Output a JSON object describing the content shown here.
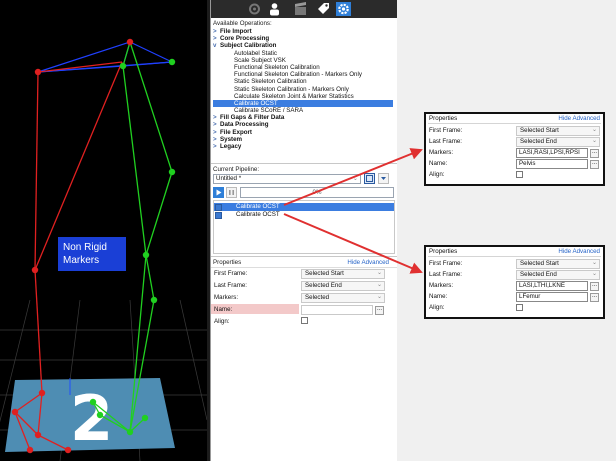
{
  "viewport": {
    "label_line1": "Non Rigid",
    "label_line2": "Markers",
    "floor_number": "2"
  },
  "toolbar": {
    "icons": [
      "gear-icon",
      "subject-icon",
      "clapperboard-icon",
      "tag-icon",
      "settings-icon"
    ],
    "active_icon": "settings-icon",
    "accent": "#2f7fd8"
  },
  "operations": {
    "title": "Available Operations:",
    "items": [
      {
        "label": "File Import",
        "bold": true,
        "expander": ">"
      },
      {
        "label": "Core Processing",
        "bold": true,
        "expander": ">"
      },
      {
        "label": "Subject Calibration",
        "bold": true,
        "expander": "v"
      },
      {
        "label": "Autolabel Static",
        "bold": false
      },
      {
        "label": "Scale Subject VSK",
        "bold": false
      },
      {
        "label": "Functional Skeleton Calibration",
        "bold": false
      },
      {
        "label": "Functional Skeleton Calibration - Markers Only",
        "bold": false
      },
      {
        "label": "Static Skeleton Calibration",
        "bold": false
      },
      {
        "label": "Static Skeleton Calibration - Markers Only",
        "bold": false
      },
      {
        "label": "Calculate Skeleton Joint & Marker Statistics",
        "bold": false
      },
      {
        "label": "Calibrate OCST",
        "bold": false,
        "selected": true
      },
      {
        "label": "Calibrate SCoRE / SARA",
        "bold": false
      },
      {
        "label": "Fill Gaps & Filter Data",
        "bold": true,
        "expander": ">"
      },
      {
        "label": "Data Processing",
        "bold": true,
        "expander": ">"
      },
      {
        "label": "File Export",
        "bold": true,
        "expander": ">"
      },
      {
        "label": "System",
        "bold": true,
        "expander": ">"
      },
      {
        "label": "Legacy",
        "bold": true,
        "expander": ">"
      }
    ]
  },
  "pipeline": {
    "title": "Current Pipeline:",
    "name": "Untitled *",
    "progress_text": "0%",
    "steps": [
      {
        "label": "Calibrate OCST",
        "checked": true,
        "selected": true
      },
      {
        "label": "Calibrate OCST",
        "checked": true,
        "selected": false
      }
    ]
  },
  "properties": {
    "title": "Properties",
    "hide_advanced": "Hide Advanced",
    "first_frame_label": "First Frame:",
    "first_frame_value": "Selected Start",
    "last_frame_label": "Last Frame:",
    "last_frame_value": "Selected End",
    "markers_label": "Markers:",
    "markers_value": "Selected",
    "name_label": "Name:",
    "name_value": "",
    "align_label": "Align:"
  },
  "callout_top": {
    "title": "Properties",
    "hide_advanced": "Hide Advanced",
    "first_frame_label": "First Frame:",
    "first_frame_value": "Selected Start",
    "last_frame_label": "Last Frame:",
    "last_frame_value": "Selected End",
    "markers_label": "Markers:",
    "markers_value": "LASI,RASI,LPSI,RPSI",
    "name_label": "Name:",
    "name_value": "Pelvis",
    "align_label": "Align:"
  },
  "callout_bottom": {
    "title": "Properties",
    "hide_advanced": "Hide Advanced",
    "first_frame_label": "First Frame:",
    "first_frame_value": "Selected Start",
    "last_frame_label": "Last Frame:",
    "last_frame_value": "Selected End",
    "markers_label": "Markers:",
    "markers_value": "LASI,LTHI,LKNE",
    "name_label": "Name:",
    "name_value": "LFemur",
    "align_label": "Align:"
  },
  "colors": {
    "selection": "#3b7de0",
    "link": "#2563c7",
    "arrow": "#e03030",
    "name_highlight": "#f3c9c9"
  }
}
